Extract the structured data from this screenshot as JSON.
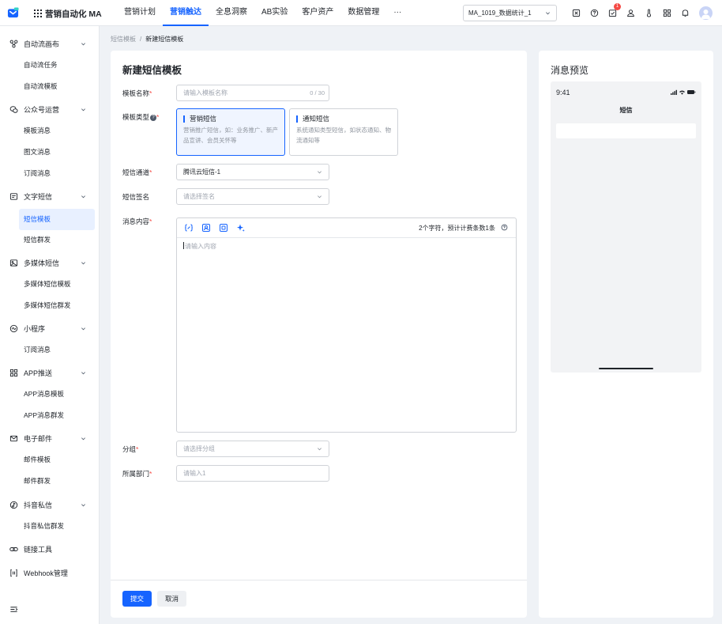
{
  "app": {
    "name": "营销自动化 MA",
    "brand_color": "#1664ff"
  },
  "nav": {
    "items": [
      "营销计划",
      "营销触达",
      "全息洞察",
      "AB实验",
      "客户资产",
      "数据管理"
    ],
    "active_index": 1,
    "more": "···"
  },
  "project_select": {
    "value": "MA_1019_数据统计_1"
  },
  "notifications": {
    "badge_count": "1"
  },
  "sidebar": {
    "groups": [
      {
        "label": "自动流画布",
        "icon": "flow-icon",
        "items": [
          "自动流任务",
          "自动流模板"
        ]
      },
      {
        "label": "公众号运营",
        "icon": "wechat-icon",
        "items": [
          "模板消息",
          "图文消息",
          "订阅消息"
        ]
      },
      {
        "label": "文字短信",
        "icon": "message-icon",
        "items": [
          "短信模板",
          "短信群发"
        ]
      },
      {
        "label": "多媒体短信",
        "icon": "image-icon",
        "items": [
          "多媒体短信模板",
          "多媒体短信群发"
        ]
      },
      {
        "label": "小程序",
        "icon": "miniprogram-icon",
        "items": [
          "订阅消息"
        ]
      },
      {
        "label": "APP推送",
        "icon": "apps-icon",
        "items": [
          "APP消息模板",
          "APP消息群发"
        ]
      },
      {
        "label": "电子邮件",
        "icon": "mail-icon",
        "items": [
          "邮件模板",
          "邮件群发"
        ]
      },
      {
        "label": "抖音私信",
        "icon": "douyin-icon",
        "items": [
          "抖音私信群发"
        ]
      }
    ],
    "singles": [
      "链接工具",
      "Webhook管理"
    ],
    "active_item": "短信模板"
  },
  "breadcrumb": {
    "parent": "短信模板",
    "separator": "/",
    "current": "新建短信模板"
  },
  "form": {
    "title": "新建短信模板",
    "template_name": {
      "label": "模板名称",
      "placeholder": "请输入模板名称",
      "counter": "0 / 30"
    },
    "template_type": {
      "label": "模板类型",
      "options": [
        {
          "title": "营销短信",
          "desc": "营销推广短信，如：业务推广、新产品宣讲、会员关怀等",
          "selected": true
        },
        {
          "title": "通知短信",
          "desc": "系统通知类型短信，如状态通知、物流通知等",
          "selected": false
        }
      ]
    },
    "channel": {
      "label": "短信通道",
      "value": "腾讯云短信-1"
    },
    "signature": {
      "label": "短信签名",
      "placeholder": "请选择签名"
    },
    "content": {
      "label": "消息内容",
      "placeholder": "请输入内容",
      "stats": "2个字符，预计计费条数1条"
    },
    "group": {
      "label": "分组",
      "placeholder": "请选择分组"
    },
    "department": {
      "label": "所属部门",
      "placeholder": "请输入1"
    },
    "submit": "提交",
    "cancel": "取消"
  },
  "preview": {
    "title": "消息预览",
    "time": "9:41",
    "chat_title": "短信"
  }
}
